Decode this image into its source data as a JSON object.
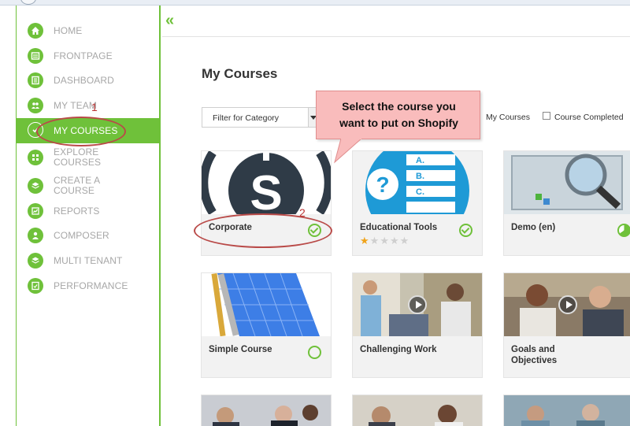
{
  "nav": {
    "items": [
      {
        "label": "HOME",
        "icon": "home-icon"
      },
      {
        "label": "FRONTPAGE",
        "icon": "frontpage-icon"
      },
      {
        "label": "DASHBOARD",
        "icon": "dashboard-icon"
      },
      {
        "label": "MY TEAM",
        "icon": "team-icon"
      },
      {
        "label": "MY COURSES",
        "icon": "courses-icon",
        "active": true
      },
      {
        "label": "EXPLORE COURSES",
        "icon": "explore-icon"
      },
      {
        "label": "CREATE A COURSE",
        "icon": "create-course-icon"
      },
      {
        "label": "REPORTS",
        "icon": "reports-icon"
      },
      {
        "label": "COMPOSER",
        "icon": "composer-icon"
      },
      {
        "label": "MULTI TENANT",
        "icon": "multi-tenant-icon"
      },
      {
        "label": "PERFORMANCE",
        "icon": "performance-icon"
      }
    ]
  },
  "header": {
    "collapse_glyph": "«"
  },
  "main": {
    "title": "My Courses",
    "filter_placeholder": "Filter for Category",
    "my_courses_link": "My Courses",
    "course_completed_label": "Course Completed"
  },
  "callout": {
    "line1": "Select the course you",
    "line2": "want to put on Shopify"
  },
  "annotations": {
    "one": "1",
    "two": "2"
  },
  "courses": [
    {
      "title": "Corporate",
      "status": "completed"
    },
    {
      "title": "Educational Tools",
      "status": "completed",
      "rating": 1,
      "rating_max": 5
    },
    {
      "title": "Demo (en)",
      "status": "in-progress"
    },
    {
      "title": "Simple Course",
      "status": "not-started"
    },
    {
      "title": "Challenging Work"
    },
    {
      "title": "Goals and Objectives"
    }
  ],
  "colors": {
    "accent": "#6fc13a",
    "callout": "#f9bcbc",
    "annotation": "#b94a48"
  }
}
